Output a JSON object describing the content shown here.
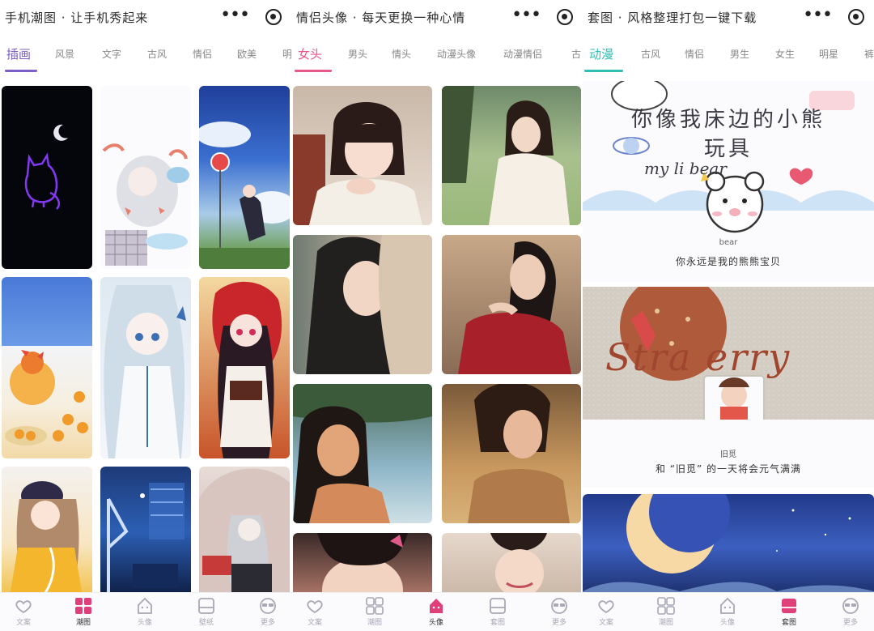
{
  "panels": [
    {
      "title": "手机潮图 · 让手机秀起来",
      "tabs": [
        "插画",
        "风景",
        "文字",
        "古风",
        "情侣",
        "欧美",
        "明"
      ],
      "bottom_nav": [
        "文案",
        "潮图",
        "头像",
        "壁纸",
        "更多"
      ],
      "active_bottom": 1
    },
    {
      "title": "情侣头像 · 每天更换一种心情",
      "tabs": [
        "女头",
        "男头",
        "情头",
        "动漫头像",
        "动漫情侣",
        "古"
      ],
      "bottom_nav": [
        "文案",
        "潮图",
        "头像",
        "套图",
        "更多"
      ],
      "active_bottom": 2
    },
    {
      "title": "套图 · 风格整理打包一键下载",
      "tabs": [
        "动漫",
        "古风",
        "情侣",
        "男生",
        "女生",
        "明星",
        "裤"
      ],
      "bottom_nav": [
        "文案",
        "潮图",
        "头像",
        "套图",
        "更多"
      ],
      "active_bottom": 3,
      "posts": [
        {
          "heading": "你像我床边的小熊玩具",
          "script_text": "my li  bear",
          "label": "bear",
          "caption": "你永远是我的熊熊宝贝"
        },
        {
          "banner_text": "Stra  erry",
          "avatar_label": "旧觅",
          "caption": "和 “旧觅” 的一天将会元气满满"
        }
      ]
    }
  ],
  "colors": {
    "panel1_accent": "#7b5fc7",
    "panel2_accent": "#e8588a",
    "panel3_accent": "#2fbfb3",
    "inactive_tab": "#888888",
    "nav_label": "#a8a8b6"
  }
}
